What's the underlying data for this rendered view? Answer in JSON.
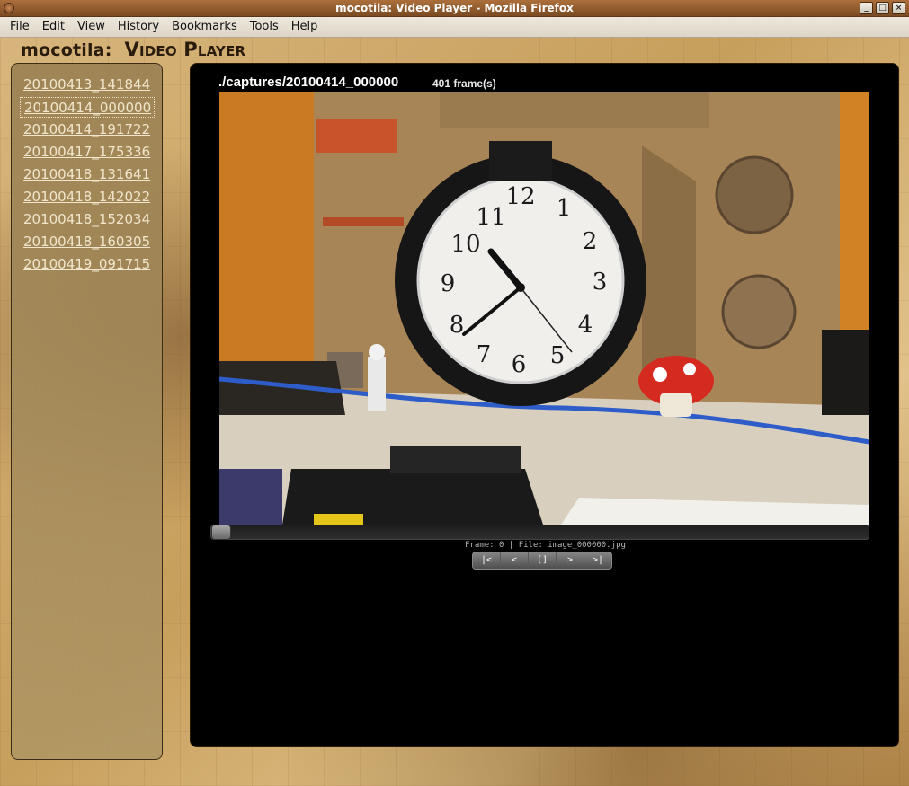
{
  "window": {
    "title": "mocotila: Video Player - Mozilla Firefox",
    "buttons": {
      "minimize": "_",
      "maximize": "□",
      "close": "×"
    }
  },
  "menubar": [
    {
      "label": "File",
      "accel": "F",
      "rest": "ile"
    },
    {
      "label": "Edit",
      "accel": "E",
      "rest": "dit"
    },
    {
      "label": "View",
      "accel": "V",
      "rest": "iew"
    },
    {
      "label": "History",
      "accel": "H",
      "rest": "istory",
      "pre": ""
    },
    {
      "label": "Bookmarks",
      "accel": "B",
      "rest": "ookmarks"
    },
    {
      "label": "Tools",
      "accel": "T",
      "rest": "ools"
    },
    {
      "label": "Help",
      "accel": "H",
      "rest": "elp"
    }
  ],
  "header": {
    "site": "mocotila:",
    "page": "Video Player"
  },
  "sidebar": {
    "captures": [
      {
        "label": "20100413_141844",
        "active": false
      },
      {
        "label": "20100414_000000",
        "active": true
      },
      {
        "label": "20100414_191722",
        "active": false
      },
      {
        "label": "20100417_175336",
        "active": false
      },
      {
        "label": "20100418_131641",
        "active": false
      },
      {
        "label": "20100418_142022",
        "active": false
      },
      {
        "label": "20100418_152034",
        "active": false
      },
      {
        "label": "20100418_160305",
        "active": false
      },
      {
        "label": "20100419_091715",
        "active": false
      }
    ]
  },
  "player": {
    "path": "./captures/20100414_000000",
    "frame_count": "401 frame(s)",
    "progress": 0,
    "status": "Frame: 0 | File: image_000000.jpg",
    "controls": [
      {
        "name": "first-frame-button",
        "label": "|<"
      },
      {
        "name": "prev-frame-button",
        "label": "<"
      },
      {
        "name": "play-pause-button",
        "label": "[]"
      },
      {
        "name": "next-frame-button",
        "label": ">"
      },
      {
        "name": "last-frame-button",
        "label": ">|"
      }
    ]
  }
}
